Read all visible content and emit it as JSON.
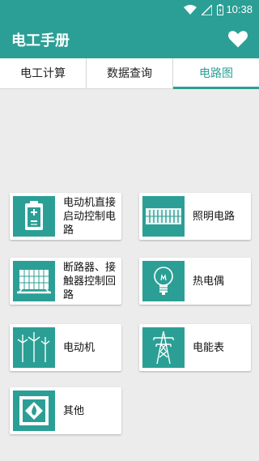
{
  "status": {
    "time": "10:38"
  },
  "app": {
    "title": "电工手册",
    "favorite_icon": "heart-icon"
  },
  "tabs": [
    {
      "label": "电工计算",
      "active": false
    },
    {
      "label": "数据查询",
      "active": false
    },
    {
      "label": "电路图",
      "active": true
    }
  ],
  "cards": [
    {
      "label": "电动机直接启动控制电路",
      "icon": "battery-control-icon"
    },
    {
      "label": "照明电路",
      "icon": "lighting-panel-icon"
    },
    {
      "label": "断路器、接触器控制回路",
      "icon": "breaker-panel-icon"
    },
    {
      "label": "热电偶",
      "icon": "light-bulb-icon"
    },
    {
      "label": "电动机",
      "icon": "wind-turbine-icon"
    },
    {
      "label": "电能表",
      "icon": "power-tower-icon"
    },
    {
      "label": "其他",
      "icon": "flammable-warning-icon"
    }
  ],
  "colors": {
    "primary": "#2b9f95",
    "background": "#ececec"
  }
}
